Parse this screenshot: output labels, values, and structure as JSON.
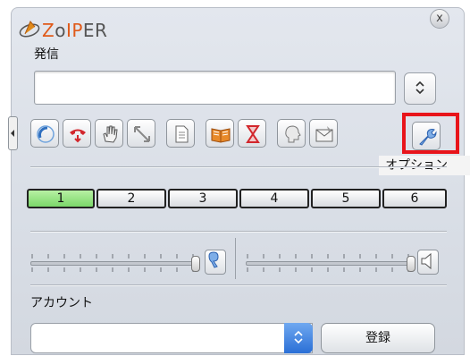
{
  "app": {
    "logo_text_z": "Z",
    "logo_text_o": "o",
    "logo_text_ip": "IP",
    "logo_text_er": "ER"
  },
  "dial": {
    "label": "発信",
    "value": "",
    "stepper": "⌃⌄"
  },
  "close": "x",
  "toolbar": {
    "buttons": [
      "call",
      "hangup",
      "hold",
      "transfer",
      "conference",
      "contacts",
      "history",
      "presence",
      "message",
      "options"
    ],
    "tooltip": "オプション"
  },
  "lines": [
    "1",
    "2",
    "3",
    "4",
    "5",
    "6"
  ],
  "active_line": "1",
  "audio": {
    "mic_level": 1.0,
    "speaker_level": 1.0
  },
  "account": {
    "label": "アカウント",
    "value": "",
    "register": "登録"
  },
  "colors": {
    "highlight": "#e8141a",
    "active_line": "#8ddc78",
    "select_arrow": "#2a6fd6"
  }
}
